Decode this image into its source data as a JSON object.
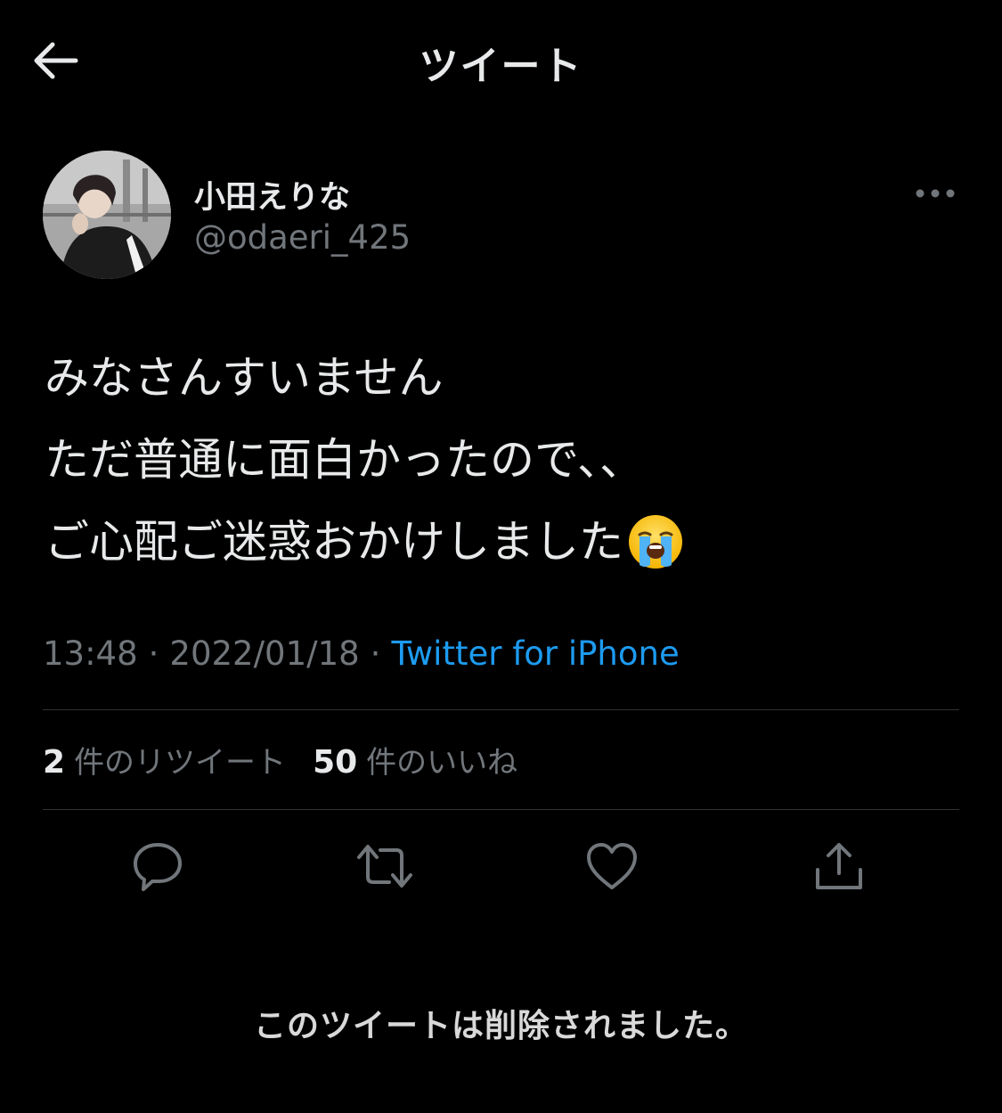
{
  "header": {
    "title": "ツイート",
    "back_icon": "arrow-left-icon"
  },
  "author": {
    "display_name": "小田えりな",
    "handle": "@odaeri_425",
    "more_icon": "more-horizontal-icon"
  },
  "tweet": {
    "lines": [
      "みなさんすいません",
      "ただ普通に面白かったので、、",
      "ご心配ご迷惑おかけしました"
    ],
    "emoji": "loudly-crying-face-emoji",
    "time": "13:48",
    "date": "2022/01/18",
    "separator": "·",
    "source": "Twitter for iPhone"
  },
  "stats": {
    "retweets_count": "2",
    "retweets_label": "件のリツイート",
    "likes_count": "50",
    "likes_label": "件のいいね"
  },
  "actions": [
    {
      "name": "reply",
      "icon": "reply-icon"
    },
    {
      "name": "retweet",
      "icon": "retweet-icon"
    },
    {
      "name": "like",
      "icon": "heart-icon"
    },
    {
      "name": "share",
      "icon": "share-icon"
    }
  ],
  "notice": "このツイートは削除されました。",
  "colors": {
    "background": "#000000",
    "text_primary": "#e7e9ea",
    "text_secondary": "#71767b",
    "link": "#1d9bf0",
    "divider": "#2f3336"
  }
}
